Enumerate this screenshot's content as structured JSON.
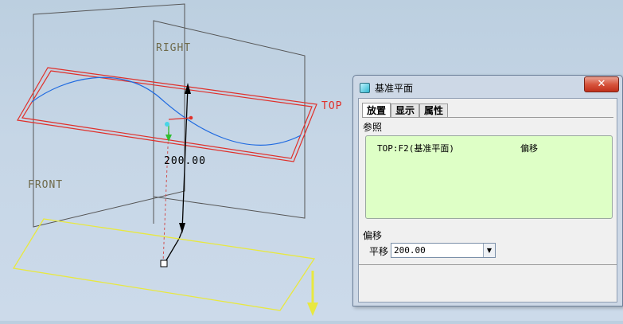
{
  "viewport": {
    "labels": {
      "right": "RIGHT",
      "top": "TOP",
      "front": "FRONT"
    },
    "dimension": "200.00"
  },
  "dialog": {
    "title": "基准平面",
    "close_symbol": "✕",
    "tabs": [
      {
        "label": "放置",
        "active": true
      },
      {
        "label": "显示",
        "active": false
      },
      {
        "label": "属性",
        "active": false
      }
    ],
    "references_label": "参照",
    "reference": {
      "name": "TOP:F2(基准平面)",
      "type": "偏移"
    },
    "offset_label": "偏移",
    "translation_label": "平移",
    "translation_value": "200.00",
    "dropdown_symbol": "▼"
  },
  "colors": {
    "datum_plane": "#555555",
    "selected_plane": "#e0302a",
    "curve": "#1f6ae0",
    "new_plane": "#e8e840",
    "ref_box_bg": "#deffc6"
  }
}
